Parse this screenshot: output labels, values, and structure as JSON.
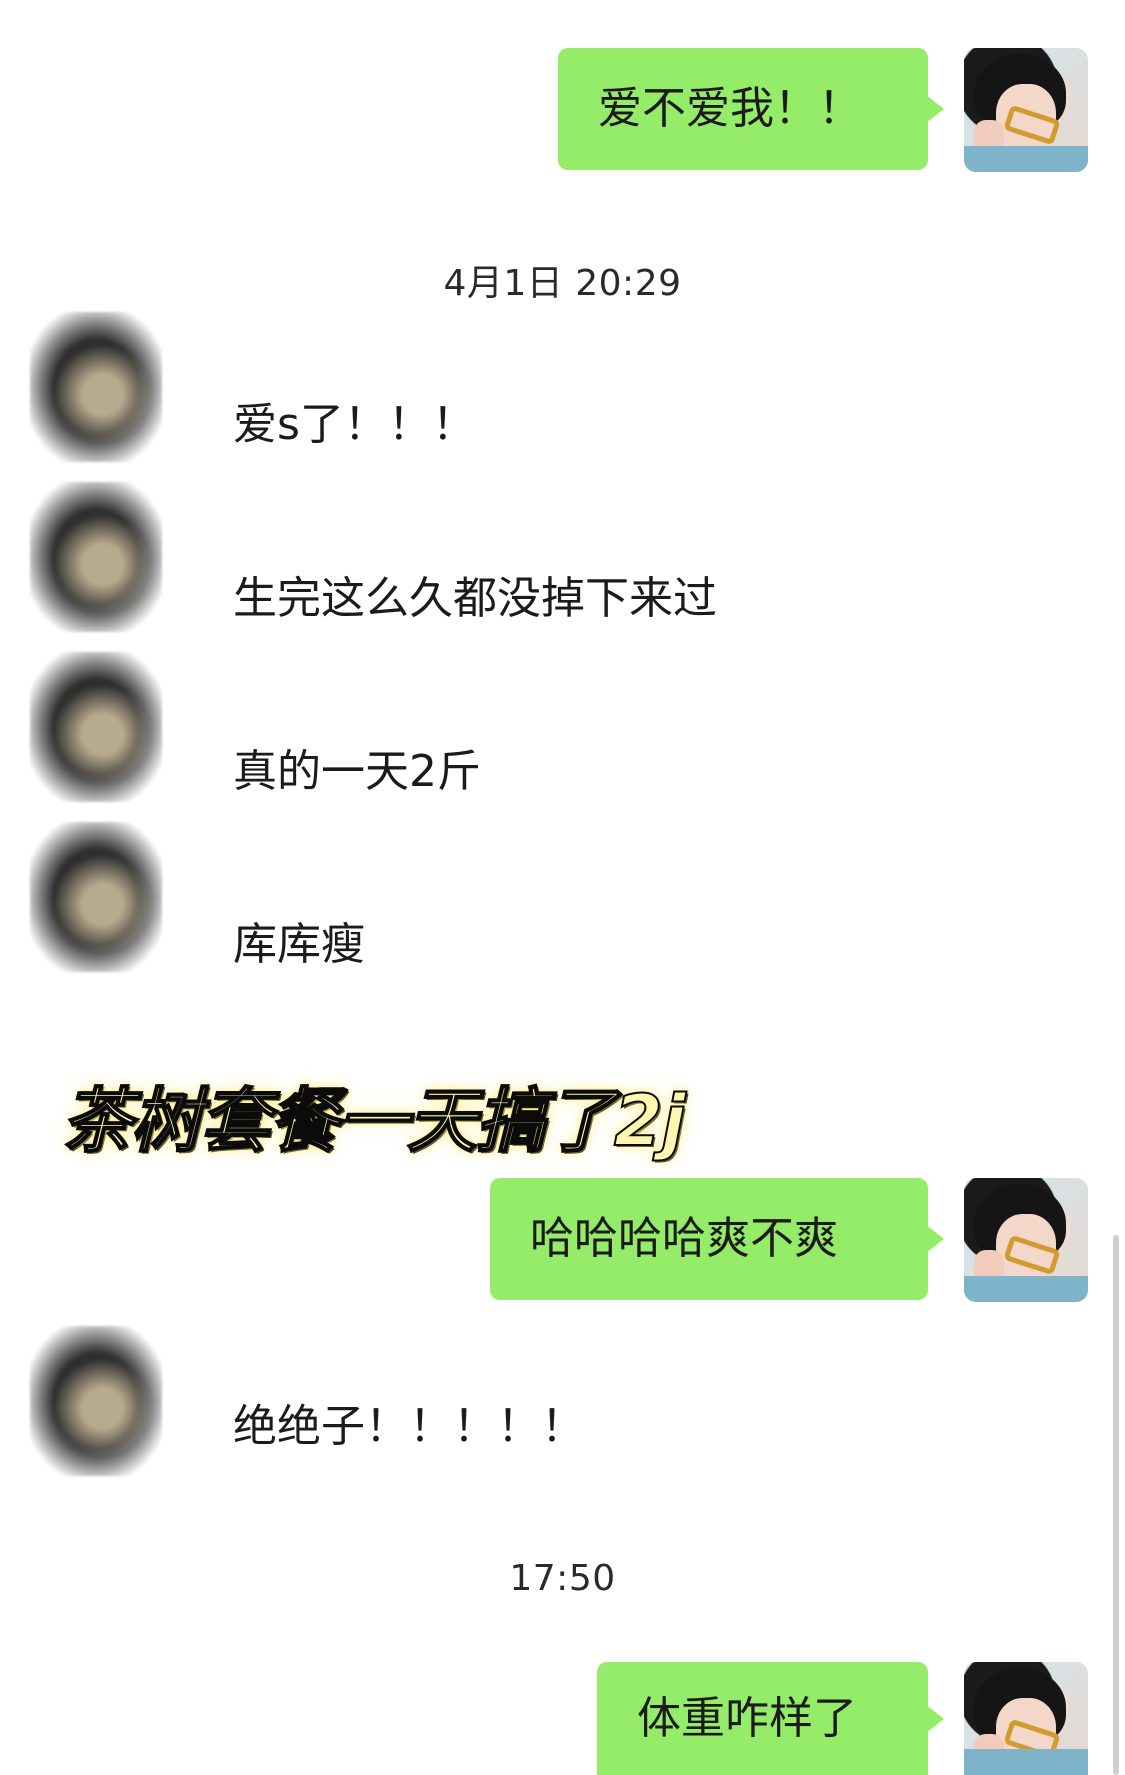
{
  "messages": {
    "outgoing": [
      {
        "text": "爱不爱我！！"
      },
      {
        "text": "哈哈哈哈爽不爽"
      },
      {
        "text": "体重咋样了"
      }
    ],
    "incoming_group_1": [
      {
        "text": "爱s了！！！"
      },
      {
        "text": "生完这么久都没掉下来过"
      },
      {
        "text": "真的一天2斤"
      },
      {
        "text": "库库瘦"
      }
    ],
    "incoming_group_2": [
      {
        "text": "绝绝子！！！！！"
      }
    ]
  },
  "timestamps": {
    "t1": "4月1日 20:29",
    "t2": "17:50"
  },
  "overlay": {
    "caption": "茶树套餐一天搞了2j"
  },
  "colors": {
    "outgoing_bubble": "#95ec69",
    "background": "#ffffff",
    "caption_fill": "#fff7b0"
  }
}
